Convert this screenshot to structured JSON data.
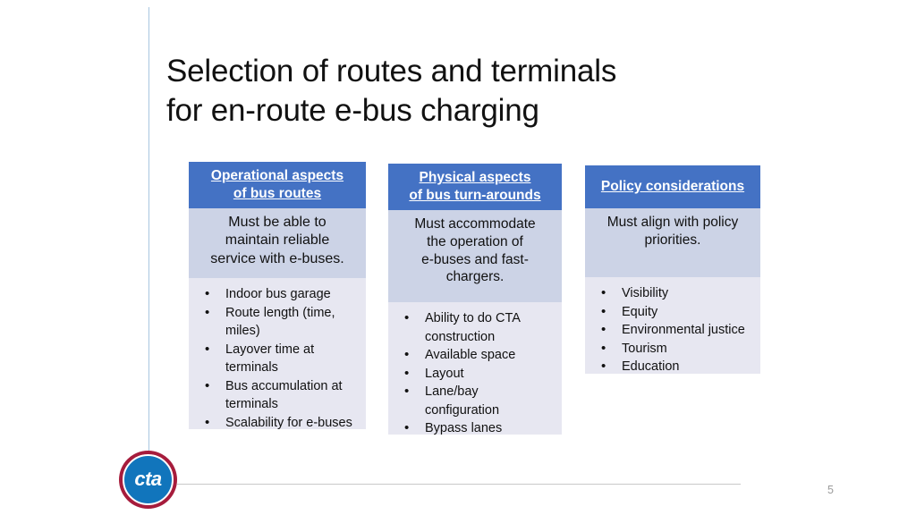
{
  "slide": {
    "title_line1": "Selection of routes and terminals",
    "title_line2": "for en-route e-bus charging",
    "page_number": "5",
    "accent_blue": "#4472C4",
    "body_fill": "#CCD3E6",
    "bullets_fill": "#E7E7F1",
    "rule_color": "#c9c9c9",
    "vrule_color": "#a8c6e0"
  },
  "logo": {
    "wordmark": "cta",
    "ring_color": "#A61C3C",
    "disc_color": "#1175BC"
  },
  "columns": [
    {
      "header_line1": "Operational aspects",
      "header_line2": "of bus routes",
      "body_line1": "Must be able to",
      "body_line2": "maintain reliable",
      "body_line3": "service with e-buses.",
      "bullets": [
        "Indoor bus garage",
        "Route length (time, miles)",
        "Layover time at terminals",
        "Bus accumulation at terminals",
        "Scalability for e-buses"
      ]
    },
    {
      "header_line1": "Physical aspects",
      "header_line2": "of bus turn-arounds",
      "body_line1": "Must accommodate",
      "body_line2": "the operation of",
      "body_line3": "e-buses and fast-",
      "body_line4": "chargers.",
      "bullets": [
        "Ability to do CTA construction",
        "Available space",
        "Layout",
        "Lane/bay configuration",
        "Bypass lanes"
      ]
    },
    {
      "header_line1": "Policy considerations",
      "body_line1": "Must align with policy",
      "body_line2": "priorities.",
      "bullets": [
        "Visibility",
        "Equity",
        "Environmental justice",
        "Tourism",
        "Education"
      ]
    }
  ]
}
